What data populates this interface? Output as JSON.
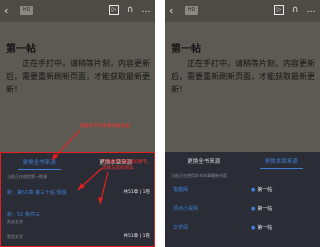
{
  "left": {
    "top_bar": {
      "back": "‹",
      "tag": "HD",
      "icons": [
        "▷",
        "∩",
        "…"
      ]
    },
    "chapter_title": "第一帖",
    "body": "正在手打中，请稍等片刻，内容更新后，需要重新刷新页面，才能获取最新更新！",
    "tabs": [
      "更换全书来源",
      "更换本章来源"
    ],
    "hint": "当前正在使用第一换源",
    "rows": [
      {
        "title": "新：第51章 第三十帖 悄悄",
        "sub": "",
        "meta": "共51章 | 1卷"
      },
      {
        "title": "新：52 条件三",
        "sub": "失去五次",
        "meta": ""
      },
      {
        "title": "",
        "sub": "奥里文学",
        "meta": "共51章 | 1卷"
      }
    ],
    "callouts": [
      "提醒您不同来源的服务器",
      "可选择不同来源的章节，选择与您的阅读"
    ]
  },
  "right": {
    "top_bar": {
      "back": "‹",
      "tag": "HD",
      "icons": [
        "▷",
        "∩",
        "…"
      ]
    },
    "chapter_title": "第一帖",
    "body": "正在手打中，请稍等片刻，内容更新后，需要重新刷新页面，才能获取最新更新！",
    "tabs": [
      "更换全书来源",
      "更换本章来源"
    ],
    "hint": "当前正在使用本书本章最新内容",
    "rows": [
      {
        "name": "笔趣阁",
        "chapter": "第一帖"
      },
      {
        "name": "顶点小说网",
        "chapter": "第一帖"
      },
      {
        "name": "文学阁",
        "chapter": "第一帖"
      }
    ]
  },
  "colors": {
    "accent": "#3d7fd6",
    "annotation": "#e02020",
    "sheet": "#2b2d36",
    "page": "#5c5a52"
  }
}
